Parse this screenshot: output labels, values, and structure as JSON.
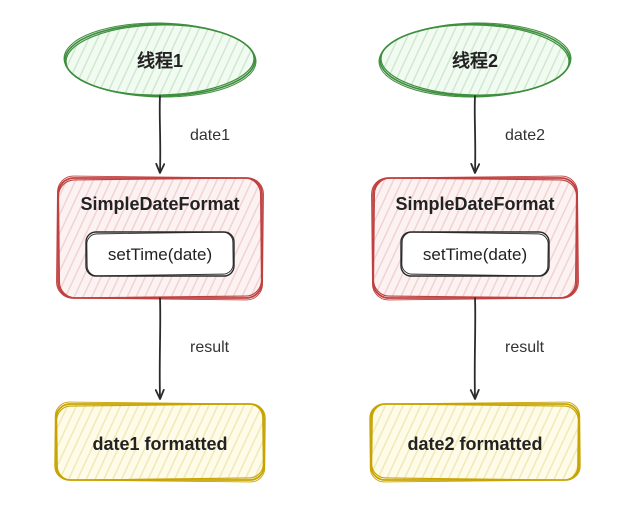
{
  "left": {
    "thread": {
      "label": "线程1"
    },
    "arrow1_label": "date1",
    "sdf": {
      "title": "SimpleDateFormat",
      "method": "setTime(date)"
    },
    "arrow2_label": "result",
    "output": {
      "label": "date1 formatted"
    }
  },
  "right": {
    "thread": {
      "label": "线程2"
    },
    "arrow1_label": "date2",
    "sdf": {
      "title": "SimpleDateFormat",
      "method": "setTime(date)"
    },
    "arrow2_label": "result",
    "output": {
      "label": "date2 formatted"
    }
  }
}
